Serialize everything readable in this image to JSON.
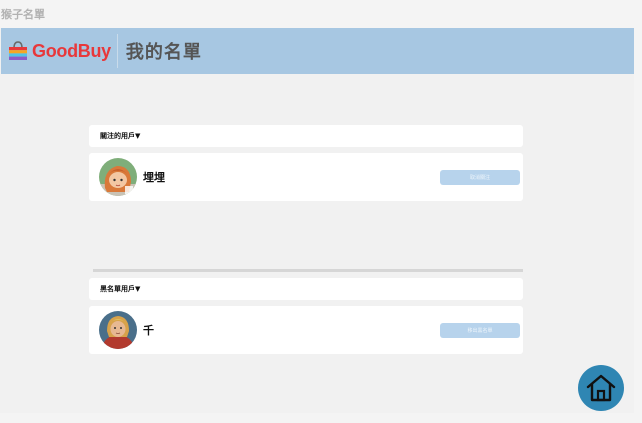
{
  "window": {
    "title": "猴子名單"
  },
  "header": {
    "logo_text": "GoodBuy",
    "page_title": "我的名單"
  },
  "followed_section": {
    "label": "關注的用戶▼",
    "users": [
      {
        "name": "埋埋",
        "action_label": "取消關注"
      }
    ]
  },
  "blacklist_section": {
    "label": "黑名單用戶▼",
    "users": [
      {
        "name": "千",
        "action_label": "移出黑名單"
      }
    ]
  },
  "icons": {
    "logo": "shopping-bag-icon",
    "home": "home-icon"
  },
  "colors": {
    "header_bg": "#a7c7e2",
    "brand_red": "#e8383b",
    "button_bg": "#b7d3ec",
    "home_bg": "#2f86b3"
  }
}
